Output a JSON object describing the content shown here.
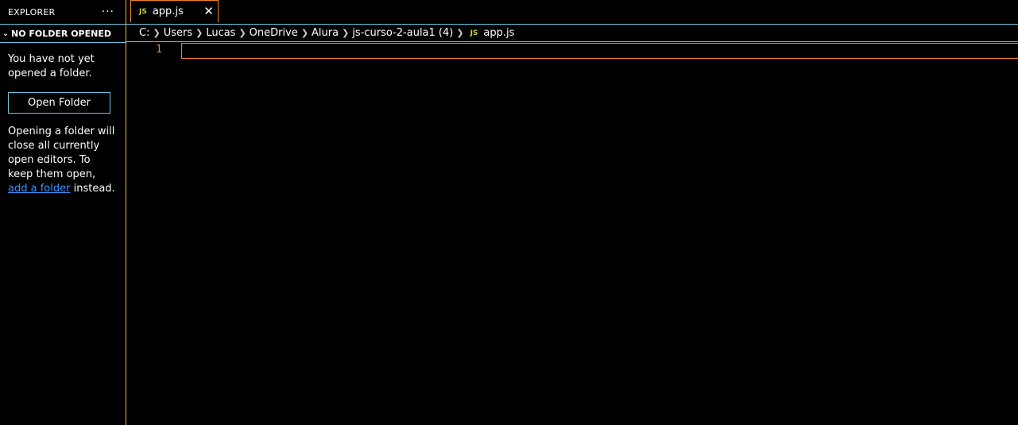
{
  "sidebar": {
    "title": "EXPLORER",
    "more_icon": "···",
    "section_title": "NO FOLDER OPENED",
    "message1": "You have not yet opened a folder.",
    "open_folder_label": "Open Folder",
    "message2_pre": "Opening a folder will close all currently open editors. To keep them open,",
    "message2_link": "add a folder",
    "message2_post": "instead."
  },
  "tab": {
    "icon": "JS",
    "label": "app.js",
    "close": "✕"
  },
  "breadcrumbs": [
    "C:",
    "Users",
    "Lucas",
    "OneDrive",
    "Alura",
    "js-curso-2-aula1 (4)"
  ],
  "breadcrumb_file": {
    "icon": "JS",
    "label": "app.js"
  },
  "editor": {
    "line_number": "1"
  },
  "colors": {
    "background": "#000000",
    "border_contrast": "#6fc3df",
    "active_border": "#f38518",
    "link": "#3794ff",
    "js_icon": "#cbcb41"
  }
}
